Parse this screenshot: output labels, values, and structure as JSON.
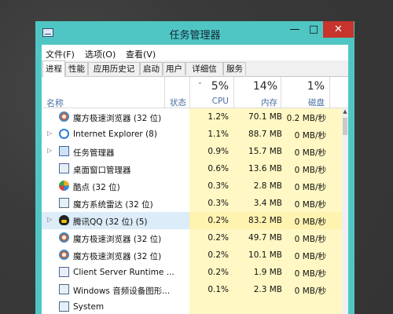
{
  "window": {
    "title": "任务管理器",
    "minimize_glyph": "—",
    "maximize_glyph": "□",
    "close_glyph": "✕",
    "accent_color": "#4fc6c3",
    "close_color": "#c7342d"
  },
  "menu": [
    "文件(F)",
    "选项(O)",
    "查看(V)"
  ],
  "tabs": [
    "进程",
    "性能",
    "应用历史记录",
    "启动",
    "用户",
    "详细信息",
    "服务"
  ],
  "header": {
    "name": "名称",
    "status": "状态",
    "sort_glyph": "⌄",
    "cpu": {
      "pct": "5%",
      "label": "CPU"
    },
    "memory": {
      "pct": "14%",
      "label": "内存"
    },
    "disk": {
      "pct": "1%",
      "label": "磁盘"
    }
  },
  "rows": [
    {
      "expand": "",
      "icon": "browser-icon",
      "name": "魔方极速浏览器 (32 位)",
      "cpu": "1.2%",
      "mem": "70.1 MB",
      "disk": "0.2 MB/秒"
    },
    {
      "expand": "▷",
      "icon": "internet-explorer-icon",
      "name": "Internet Explorer (8)",
      "cpu": "1.1%",
      "mem": "88.7 MB",
      "disk": "0 MB/秒"
    },
    {
      "expand": "▷",
      "icon": "task-manager-icon",
      "name": "任务管理器",
      "cpu": "0.9%",
      "mem": "15.7 MB",
      "disk": "0 MB/秒"
    },
    {
      "expand": "",
      "icon": "window-icon",
      "name": "桌面窗口管理器",
      "cpu": "0.6%",
      "mem": "13.6 MB",
      "disk": "0 MB/秒"
    },
    {
      "expand": "",
      "icon": "kudian-icon",
      "name": "酷点 (32 位)",
      "cpu": "0.3%",
      "mem": "2.8 MB",
      "disk": "0 MB/秒"
    },
    {
      "expand": "",
      "icon": "radar-icon",
      "name": "魔方系统雷达 (32 位)",
      "cpu": "0.3%",
      "mem": "3.4 MB",
      "disk": "0 MB/秒"
    },
    {
      "expand": "▷",
      "icon": "qq-icon",
      "name": "腾讯QQ (32 位) (5)",
      "cpu": "0.2%",
      "mem": "83.2 MB",
      "disk": "0 MB/秒"
    },
    {
      "expand": "",
      "icon": "browser-icon",
      "name": "魔方极速浏览器 (32 位)",
      "cpu": "0.2%",
      "mem": "49.7 MB",
      "disk": "0 MB/秒"
    },
    {
      "expand": "",
      "icon": "browser-icon",
      "name": "魔方极速浏览器 (32 位)",
      "cpu": "0.2%",
      "mem": "10.1 MB",
      "disk": "0 MB/秒"
    },
    {
      "expand": "",
      "icon": "window-icon",
      "name": "Client Server Runtime ...",
      "cpu": "0.2%",
      "mem": "1.9 MB",
      "disk": "0 MB/秒"
    },
    {
      "expand": "",
      "icon": "window-icon",
      "name": "Windows 音频设备图形...",
      "cpu": "0.1%",
      "mem": "2.3 MB",
      "disk": "0 MB/秒"
    },
    {
      "expand": "",
      "icon": "window-icon",
      "name": "System",
      "cpu": "",
      "mem": "",
      "disk": ""
    }
  ],
  "highlighted_row": 6,
  "scroll_up_glyph": "▲"
}
